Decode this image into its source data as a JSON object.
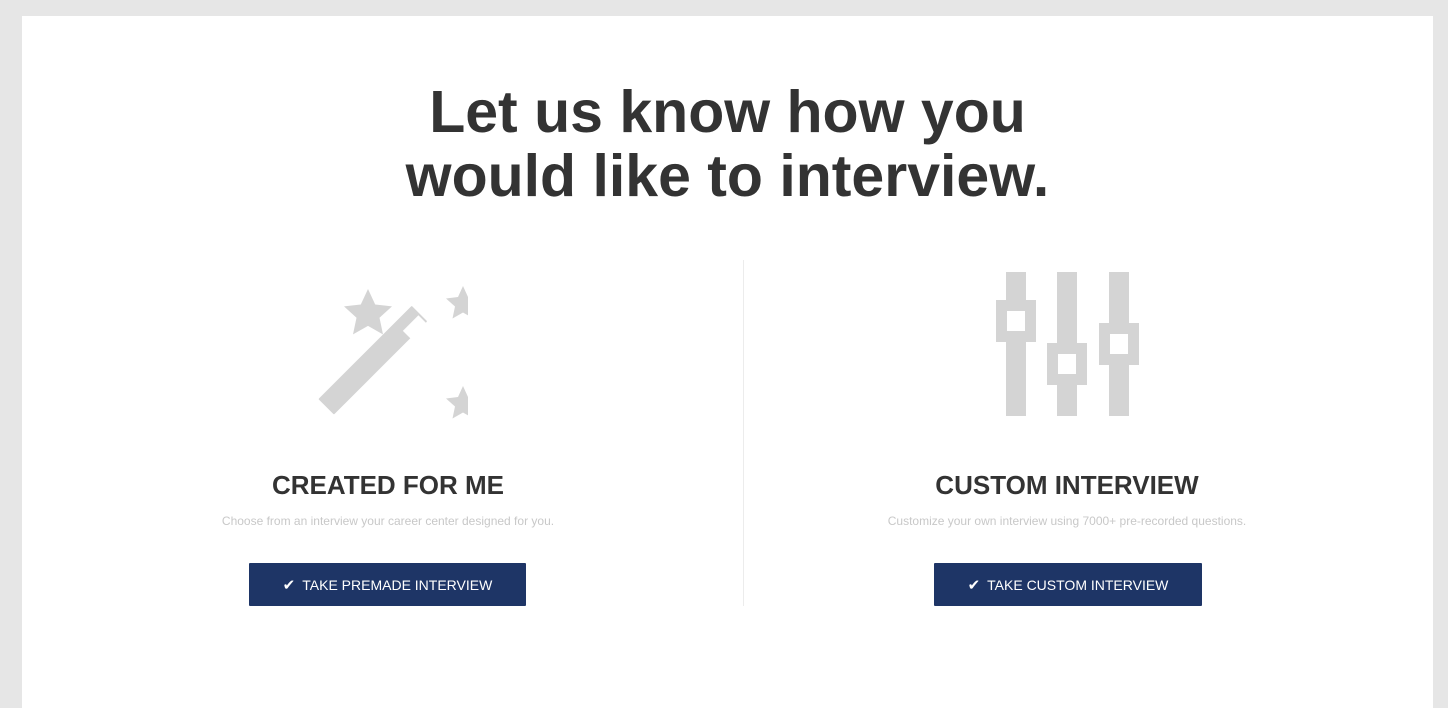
{
  "page": {
    "heading_line1": "Let us know how you",
    "heading_line2": "would like to interview."
  },
  "options": {
    "premade": {
      "icon": "magic-wand-icon",
      "title": "CREATED FOR ME",
      "description": "Choose from an interview your career center designed for you.",
      "button_label": "TAKE PREMADE INTERVIEW",
      "button_icon": "checkmark-icon"
    },
    "custom": {
      "icon": "sliders-icon",
      "title": "CUSTOM INTERVIEW",
      "description": "Customize your own interview using 7000+ pre-recorded questions.",
      "button_label": "TAKE CUSTOM INTERVIEW",
      "button_icon": "checkmark-icon"
    }
  },
  "colors": {
    "button_bg": "#1e3566",
    "icon_gray": "#d4d4d4",
    "heading_text": "#333333",
    "description_text": "#c8c8c8",
    "page_bg": "#e6e6e6"
  }
}
